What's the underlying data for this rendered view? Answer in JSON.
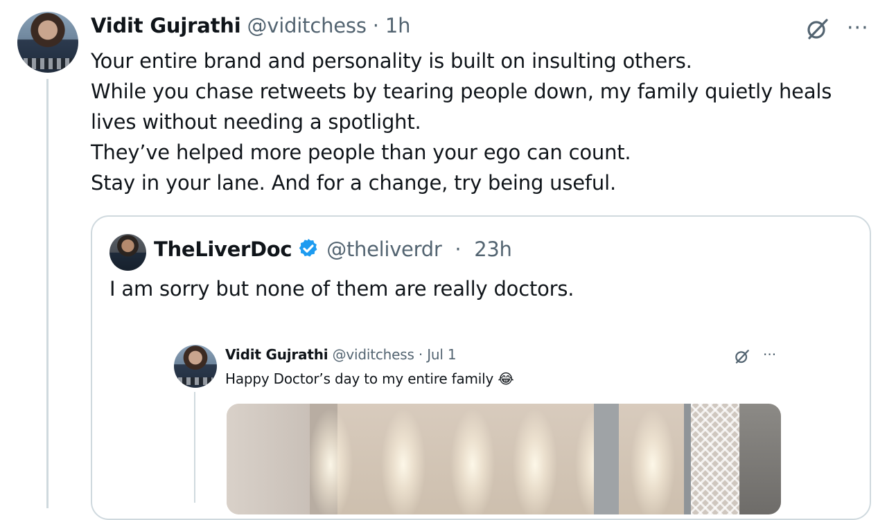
{
  "main_tweet": {
    "name": "Vidit Gujrathi",
    "handle": "@viditchess",
    "separator": "·",
    "time": "1h",
    "lines": [
      "Your entire brand and personality is built on insulting others.",
      "While you chase retweets by tearing people down, my family quietly heals",
      "lives without needing a spotlight.",
      "They’ve helped more people than your ego can count.",
      "Stay in your lane. And for a change, try being useful."
    ],
    "more_label": "···"
  },
  "quoted_tweet": {
    "name": "TheLiverDoc",
    "handle": "@theliverdr",
    "separator": "·",
    "time": "23h",
    "text": "I am sorry but none of them are really doctors.",
    "verified_color": "#1d9bf0"
  },
  "nested_tweet": {
    "name": "Vidit Gujrathi",
    "handle": "@viditchess",
    "separator": "·",
    "time": "Jul 1",
    "text": "Happy Doctor’s day to my entire family 😂",
    "more_label": "···"
  },
  "icons": {
    "grok": "grok-icon",
    "more": "more-icon",
    "verified": "verified-badge-icon"
  }
}
